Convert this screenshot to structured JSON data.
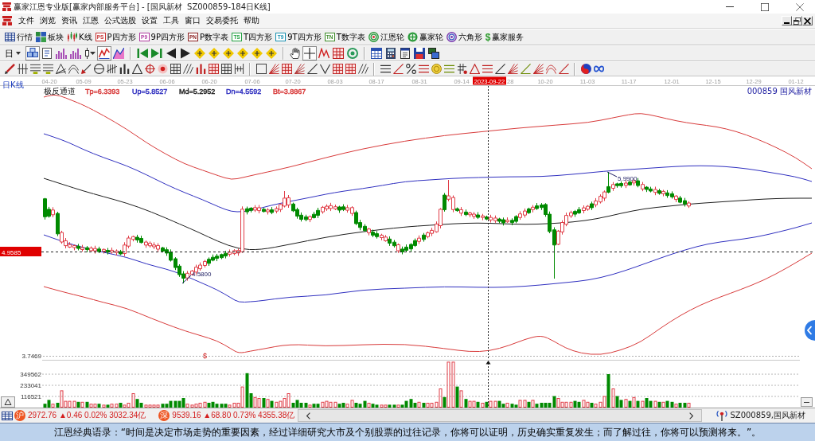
{
  "window": {
    "title": "赢家江恩专业版[赢家内部服务平台] - [国风新材  SZ000859-184日K线]"
  },
  "menu": [
    "文件",
    "浏览",
    "资讯",
    "江恩",
    "公式选股",
    "设置",
    "工具",
    "窗口",
    "交易委托",
    "帮助"
  ],
  "toolbar_main": [
    {
      "kind": "table",
      "label": "行情"
    },
    {
      "kind": "blocks",
      "label": "板块"
    },
    {
      "kind": "candles",
      "label": "K线"
    },
    {
      "kind": "letters",
      "badge": "PS",
      "color": "#c83232",
      "label": "P四方形"
    },
    {
      "kind": "letters",
      "badge": "P9",
      "color": "#b03ca0",
      "label": "9P四方形"
    },
    {
      "kind": "letters",
      "badge": "PN",
      "color": "#8c2020",
      "label": "P数字表"
    },
    {
      "kind": "letters",
      "badge": "TS",
      "color": "#20a040",
      "label": "T四方形"
    },
    {
      "kind": "letters",
      "badge": "T9",
      "color": "#1890b0",
      "label": "9T四方形"
    },
    {
      "kind": "letters",
      "badge": "TN",
      "color": "#3c8c28",
      "label": "T数字表"
    },
    {
      "kind": "target",
      "label": "江恩轮"
    },
    {
      "kind": "wheel",
      "label": "赢家轮"
    },
    {
      "kind": "rings",
      "label": "六角形"
    },
    {
      "kind": "sign",
      "badge": "$",
      "label": "赢家服务"
    }
  ],
  "toolbar_tools": {
    "period": "日",
    "groups": [
      [
        {
          "kind": "cubes",
          "pressed": true
        },
        {
          "kind": "document",
          "pressed": false
        },
        {
          "kind": "bars",
          "pressed": false
        },
        {
          "kind": "bars",
          "pressed": false
        },
        {
          "kind": "candle",
          "pressed": false
        },
        {
          "kind": "zigzag",
          "pressed": true
        },
        {
          "kind": "area",
          "pressed": false
        }
      ],
      [
        {
          "kind": "first",
          "pressed": false
        },
        {
          "kind": "last",
          "pressed": false
        },
        {
          "kind": "left",
          "pressed": false
        },
        {
          "kind": "right",
          "pressed": false
        },
        {
          "kind": "diamond",
          "pressed": false
        },
        {
          "kind": "diamond",
          "pressed": false
        },
        {
          "kind": "diamond",
          "pressed": false
        },
        {
          "kind": "diamond",
          "pressed": false
        },
        {
          "kind": "diamond",
          "pressed": false
        },
        {
          "kind": "diamond",
          "pressed": false
        }
      ],
      [
        {
          "kind": "hand",
          "pressed": false
        },
        {
          "kind": "plus",
          "pressed": true
        },
        {
          "kind": "peaks",
          "pressed": false
        },
        {
          "kind": "grid",
          "pressed": false
        },
        {
          "kind": "ring",
          "pressed": false
        }
      ],
      [
        {
          "kind": "calendar",
          "pressed": false
        },
        {
          "kind": "calculator",
          "pressed": false
        },
        {
          "kind": "notepad",
          "pressed": false
        },
        {
          "kind": "floppy",
          "pressed": false
        },
        {
          "kind": "monitor",
          "pressed": false
        }
      ]
    ]
  },
  "chart": {
    "period_label": "日K线",
    "dates": [
      "04-20",
      "05-09",
      "05-23",
      "06-06",
      "06-20",
      "07-06",
      "07-20",
      "08-03",
      "08-17",
      "08-31",
      "09-14",
      "28",
      "10-20",
      "11-03",
      "11-17",
      "12-01",
      "12-15",
      "12-29",
      "01-12"
    ],
    "cursor_date": "2023-09-22",
    "cursor_price": "4.9585",
    "indicator": {
      "name": "极反通道",
      "values": [
        {
          "text": "Tp=6.3393",
          "color": "#d83a3a"
        },
        {
          "text": "Up=5.8527",
          "color": "#3030c0"
        },
        {
          "text": "Md=5.2952",
          "color": "#1e1e1e"
        },
        {
          "text": "Dn=4.5592",
          "color": "#3030c0"
        },
        {
          "text": "Bt=3.8867",
          "color": "#d83a3a"
        }
      ]
    },
    "stock": "000859 国风新材",
    "high_label": "5.9900",
    "low_label": "4.5800",
    "floor_label": "3.7469",
    "marker": "$"
  },
  "volume": {
    "chart_data": {
      "type": "bar",
      "grid": true,
      "ylim": [
        0,
        500000
      ],
      "yticks": [
        116521,
        233041,
        349562
      ],
      "values": [
        40000,
        80000,
        40000,
        50000,
        180000,
        70000,
        70000,
        70000,
        60000,
        60000,
        60000,
        40000,
        40000,
        40000,
        30000,
        30000,
        40000,
        40000,
        50000,
        30000,
        50000,
        150000,
        90000,
        50000,
        30000,
        30000,
        30000,
        30000,
        40000,
        40000,
        70000,
        70000,
        70000,
        100000,
        40000,
        30000,
        40000,
        50000,
        60000,
        50000,
        60000,
        40000,
        40000,
        40000,
        30000,
        50000,
        50000,
        220000,
        360000,
        150000,
        110000,
        100000,
        100000,
        90000,
        70000,
        60000,
        70000,
        100000,
        150000,
        50000,
        80000,
        50000,
        50000,
        30000,
        40000,
        40000,
        60000,
        70000,
        60000,
        60000,
        40000,
        50000,
        40000,
        80000,
        50000,
        40000,
        70000,
        50000,
        40000,
        30000,
        30000,
        30000,
        30000,
        30000,
        30000,
        30000,
        70000,
        90000,
        50000,
        60000,
        50000,
        50000,
        50000,
        60000,
        200000,
        110000,
        480000,
        480000,
        220000,
        180000,
        90000,
        70000,
        70000,
        60000,
        50000,
        60000,
        70000,
        70000,
        70000,
        40000,
        50000,
        40000,
        30000,
        80000,
        80000,
        60000,
        80000,
        40000,
        50000,
        50000,
        50000,
        120000,
        100000,
        60000,
        60000,
        60000,
        70000,
        60000,
        80000,
        60000,
        50000,
        40000,
        60000,
        120000,
        350000,
        200000,
        120000,
        80000,
        90000,
        70000,
        110000,
        70000,
        70000,
        100000,
        70000,
        70000,
        60000,
        60000,
        70000,
        60000,
        40000,
        50000,
        50000,
        50000,
        null,
        null,
        null,
        null,
        null,
        null,
        null,
        null,
        null,
        null,
        null,
        null,
        null,
        null,
        null,
        null,
        null,
        null,
        null,
        null,
        null,
        null,
        null,
        null,
        null,
        null
      ]
    },
    "bars": [
      {
        "rising": false
      },
      {
        "rising": false
      },
      {
        "rising": true
      },
      {
        "rising": false
      },
      {
        "rising": true
      },
      {
        "rising": true
      },
      {
        "rising": true
      },
      {
        "rising": true
      },
      {
        "rising": false
      },
      {
        "rising": true
      },
      {
        "rising": false
      },
      {
        "rising": true
      },
      {
        "rising": true
      },
      {
        "rising": false
      },
      {
        "rising": true
      },
      {
        "rising": false
      },
      {
        "rising": true
      },
      {
        "rising": true
      },
      {
        "rising": false
      },
      {
        "rising": true
      },
      {
        "rising": true
      },
      {
        "rising": true
      },
      {
        "rising": false
      },
      {
        "rising": false
      },
      {
        "rising": true
      },
      {
        "rising": true
      },
      {
        "rising": true
      },
      {
        "rising": true
      },
      {
        "rising": false
      },
      {
        "rising": false
      },
      {
        "rising": false
      },
      {
        "rising": false
      },
      {
        "rising": false
      },
      {
        "rising": false
      },
      {
        "rising": true
      },
      {
        "rising": true
      },
      {
        "rising": true
      },
      {
        "rising": true
      },
      {
        "rising": true
      },
      {
        "rising": false
      },
      {
        "rising": false
      },
      {
        "rising": false
      },
      {
        "rising": false
      },
      {
        "rising": false
      },
      {
        "rising": true
      },
      {
        "rising": true
      },
      {
        "rising": true
      },
      {
        "rising": true
      },
      {
        "rising": false
      },
      {
        "rising": false
      },
      {
        "rising": true
      },
      {
        "rising": true
      },
      {
        "rising": false
      },
      {
        "rising": true
      },
      {
        "rising": false
      },
      {
        "rising": true
      },
      {
        "rising": true
      },
      {
        "rising": true
      },
      {
        "rising": true
      },
      {
        "rising": false
      },
      {
        "rising": false
      },
      {
        "rising": false
      },
      {
        "rising": false
      },
      {
        "rising": true
      },
      {
        "rising": false
      },
      {
        "rising": false
      },
      {
        "rising": true
      },
      {
        "rising": true
      },
      {
        "rising": true
      },
      {
        "rising": true
      },
      {
        "rising": false
      },
      {
        "rising": false
      },
      {
        "rising": true
      },
      {
        "rising": true
      },
      {
        "rising": false
      },
      {
        "rising": false
      },
      {
        "rising": false
      },
      {
        "rising": true
      },
      {
        "rising": false
      },
      {
        "rising": false
      },
      {
        "rising": true
      },
      {
        "rising": true
      },
      {
        "rising": false
      },
      {
        "rising": false
      },
      {
        "rising": true
      },
      {
        "rising": false
      },
      {
        "rising": false
      },
      {
        "rising": false
      },
      {
        "rising": false
      },
      {
        "rising": true
      },
      {
        "rising": false
      },
      {
        "rising": true
      },
      {
        "rising": true
      },
      {
        "rising": true
      },
      {
        "rising": true
      },
      {
        "rising": false
      },
      {
        "rising": true
      },
      {
        "rising": true
      },
      {
        "rising": false
      },
      {
        "rising": true
      },
      {
        "rising": false
      },
      {
        "rising": true
      },
      {
        "rising": true
      },
      {
        "rising": false
      },
      {
        "rising": true
      },
      {
        "rising": false
      },
      {
        "rising": true
      },
      {
        "rising": true
      },
      {
        "rising": false
      },
      {
        "rising": false
      },
      {
        "rising": true
      },
      {
        "rising": false
      },
      {
        "rising": false
      },
      {
        "rising": true
      },
      {
        "rising": true
      },
      {
        "rising": false
      },
      {
        "rising": true
      },
      {
        "rising": false
      },
      {
        "rising": false
      },
      {
        "rising": false
      },
      {
        "rising": false
      },
      {
        "rising": false
      },
      {
        "rising": true
      },
      {
        "rising": true
      },
      {
        "rising": true
      },
      {
        "rising": true
      },
      {
        "rising": false
      },
      {
        "rising": false
      },
      {
        "rising": true
      },
      {
        "rising": true
      },
      {
        "rising": false
      },
      {
        "rising": true
      },
      {
        "rising": true
      },
      {
        "rising": true
      },
      {
        "rising": false
      },
      {
        "rising": true
      },
      {
        "rising": false
      },
      {
        "rising": false
      },
      {
        "rising": true
      },
      {
        "rising": false
      },
      {
        "rising": true
      },
      {
        "rising": false
      },
      {
        "rising": true
      },
      {
        "rising": false
      },
      {
        "rising": false
      },
      {
        "rising": true
      },
      {
        "rising": false
      },
      {
        "rising": true
      },
      {
        "rising": false
      },
      {
        "rising": false
      },
      {
        "rising": true
      },
      {
        "rising": false
      },
      {
        "rising": false
      },
      {
        "rising": true
      }
    ]
  },
  "status_bar": {
    "quotes": [
      {
        "badge": "沪",
        "text": "2972.76 ▲0.46 0.02% 3032.34亿"
      },
      {
        "badge": "深",
        "text": "9539.16 ▲68.80 0.73% 4355.38亿"
      }
    ],
    "stock": "SZ000859,国风新材"
  },
  "quote_bar": {
    "text": "江恩经典语录：“时间是决定市场走势的重要因素，经过详细研究大市及个别股票的过往记录，你将可以证明，历史确实重复发生；而了解过往，你将可以预测将来。”。"
  }
}
